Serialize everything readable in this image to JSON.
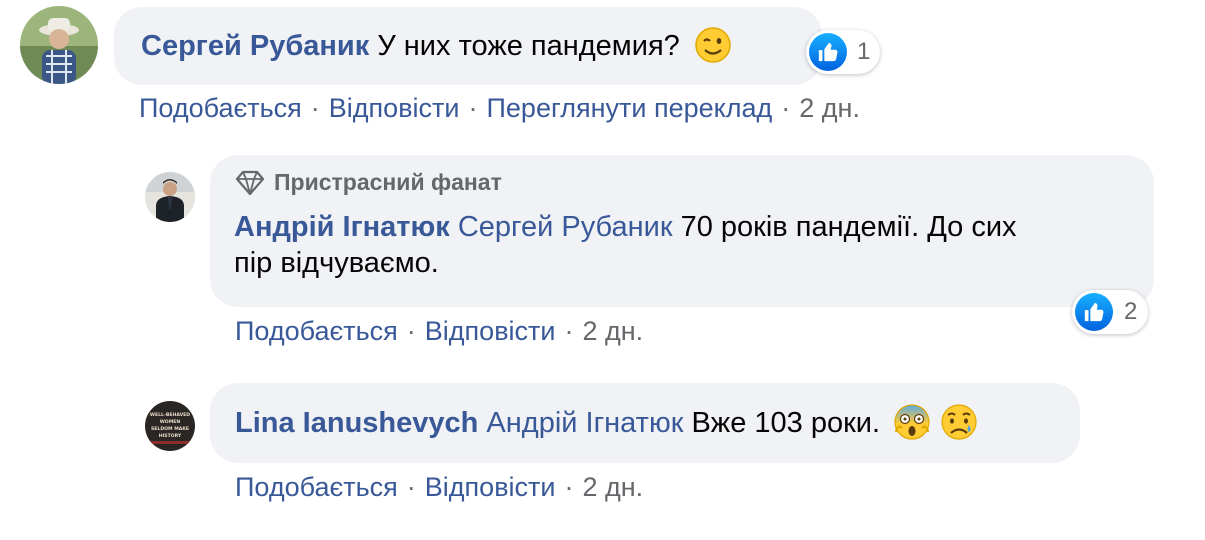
{
  "comments": [
    {
      "author": "Сергей Рубаник",
      "mention": "",
      "text": "У них тоже пандемия?",
      "reaction_count": "1",
      "actions": {
        "like": "Подобається",
        "reply": "Відповісти",
        "translate": "Переглянути переклад",
        "time": "2 дн."
      }
    },
    {
      "badge": "Пристрасний фанат",
      "author": "Андрій Ігнатюк",
      "mention": "Сергей Рубаник",
      "text_line1": "70 років пандемії. До сих",
      "text_line2": "пір відчуваємо.",
      "reaction_count": "2",
      "actions": {
        "like": "Подобається",
        "reply": "Відповісти",
        "time": "2 дн."
      }
    },
    {
      "author": "Lina Ianushevych",
      "mention": "Андрій Ігнатюк",
      "text": "Вже 103 роки.",
      "actions": {
        "like": "Подобається",
        "reply": "Відповісти",
        "time": "2 дн."
      }
    }
  ],
  "avatar_cover_text": "WELL-BEHAVED WOMEN SELDOM MAKE HISTORY",
  "icons": [
    "wink-emoji-icon",
    "like-icon",
    "diamond-icon",
    "scream-emoji-icon",
    "sad-emoji-icon"
  ],
  "colors": {
    "link": "#385898",
    "muted": "#65676b",
    "bubble": "#f0f2f5",
    "like": "#1877f2"
  }
}
